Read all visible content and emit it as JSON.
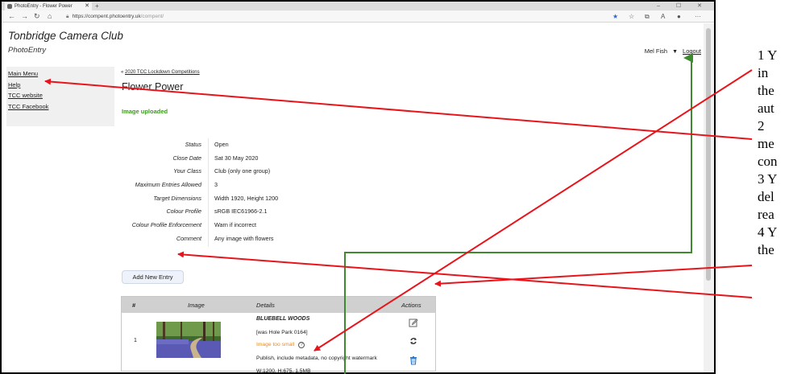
{
  "browser": {
    "tab_title": "PhotoEntry - Flower Power",
    "tab_close": "✕",
    "new_tab": "+",
    "window_controls": "–  ☐  ✕",
    "url_host": "https://compent.photoentry.uk",
    "url_path": "/compent/"
  },
  "header": {
    "club_name": "Tonbridge Camera Club",
    "site_name": "PhotoEntry",
    "user_name": "Mel Fish",
    "user_caret": "▼",
    "logout_label": "Logout"
  },
  "sidebar": {
    "items": [
      {
        "label": "Main Menu"
      },
      {
        "label": "Help"
      },
      {
        "label": "TCC website"
      },
      {
        "label": "TCC Facebook"
      }
    ]
  },
  "breadcrumb": {
    "prefix": "«",
    "link": "2020 TCC Lockdown Competitions"
  },
  "competition": {
    "title": "Flower Power",
    "message": "Image uploaded",
    "details": [
      {
        "label": "Status",
        "value": "Open"
      },
      {
        "label": "Close Date",
        "value": "Sat 30 May 2020"
      },
      {
        "label": "Your Class",
        "value": "Club (only one group)"
      },
      {
        "label": "Maximum Entries Allowed",
        "value": "3"
      },
      {
        "label": "Target Dimensions",
        "value": "Width 1920, Height 1200"
      },
      {
        "label": "Colour Profile",
        "value": "sRGB IEC61966-2.1"
      },
      {
        "label": "Colour Profile Enforcement",
        "value": "Warn if incorrect"
      },
      {
        "label": "Comment",
        "value": "Any image with flowers"
      }
    ],
    "add_button_label": "Add New Entry"
  },
  "entries_table": {
    "headers": {
      "number": "#",
      "image": "Image",
      "details": "Details",
      "actions": "Actions"
    },
    "rows": [
      {
        "number": "1",
        "title": "BLUEBELL WOODS",
        "source": "[was Hole Park 0164]",
        "warning": "Image too small",
        "warning_help": "?",
        "publish": "Publish, include metadata, no copyright watermark",
        "dimensions": "W:1200, H:675, 1.5MB"
      }
    ]
  },
  "annotations": {
    "steps": [
      "1 Y",
      "in",
      "the",
      "aut",
      "2",
      "me",
      "con",
      "3 Y",
      "del",
      "rea",
      "4 Y",
      "the"
    ],
    "arrow_color_red": "#e8141b",
    "arrow_color_green": "#3e8a2e"
  },
  "colors": {
    "success": "#3a9a1f",
    "warning": "#ef8a17",
    "table_header": "#d0d0d0"
  }
}
